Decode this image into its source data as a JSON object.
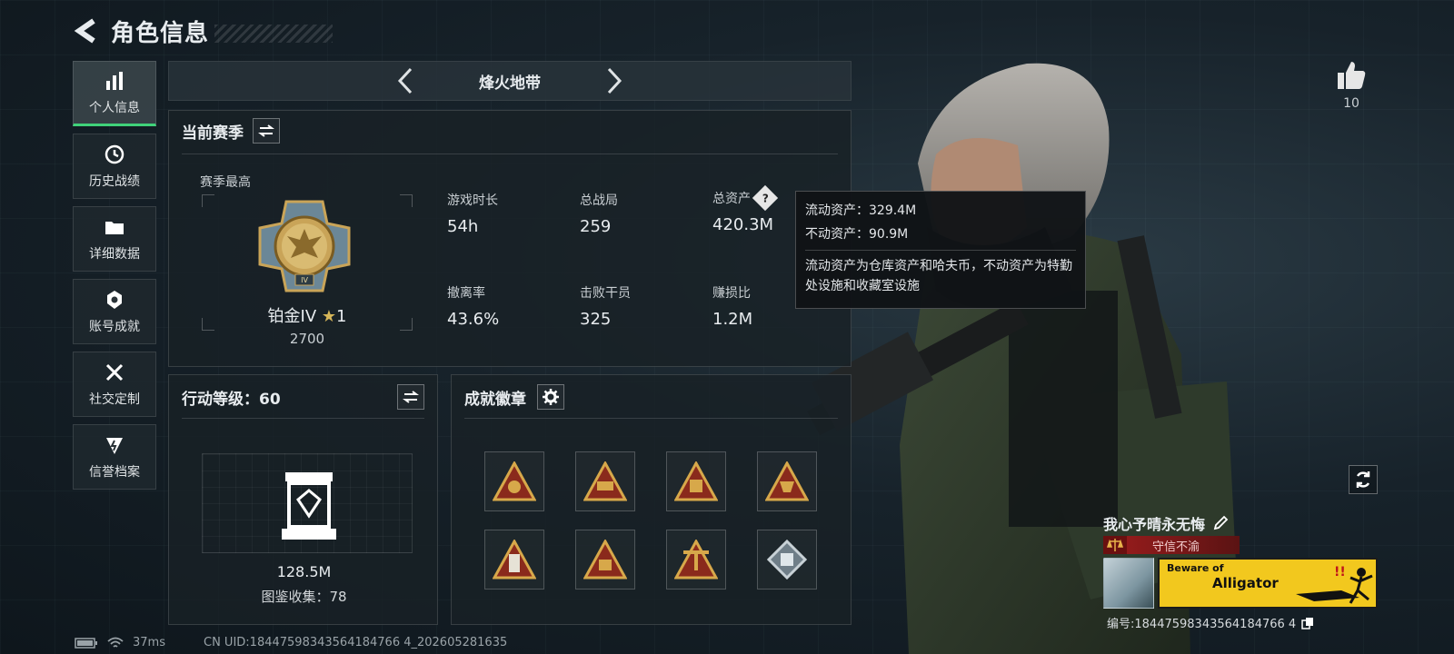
{
  "header": {
    "title": "角色信息"
  },
  "sidebar": {
    "items": [
      {
        "label": "个人信息",
        "icon": "bar-chart-icon",
        "active": true
      },
      {
        "label": "历史战绩",
        "icon": "history-icon"
      },
      {
        "label": "详细数据",
        "icon": "folder-icon"
      },
      {
        "label": "账号成就",
        "icon": "achievement-icon"
      },
      {
        "label": "社交定制",
        "icon": "tools-icon"
      },
      {
        "label": "信誉档案",
        "icon": "credit-icon"
      }
    ]
  },
  "top_nav": {
    "title": "烽火地带"
  },
  "season": {
    "title": "当前赛季",
    "best_label": "赛季最高",
    "rank_name": "铂金IV",
    "rank_stars": "1",
    "rank_score": "2700",
    "stats": [
      {
        "label": "游戏时长",
        "value": "54h"
      },
      {
        "label": "总战局",
        "value": "259"
      },
      {
        "label": "总资产",
        "value": "420.3M"
      },
      {
        "label": "撤离率",
        "value": "43.6%"
      },
      {
        "label": "击败干员",
        "value": "325"
      },
      {
        "label": "赚损比",
        "value": "1.2M"
      }
    ]
  },
  "tooltip": {
    "liquid": "流动资产：329.4M",
    "fixed": "不动资产：90.9M",
    "desc": "流动资产为仓库资产和哈夫币，不动资产为特勤处设施和收藏室设施"
  },
  "action_level": {
    "title": "行动等级：60",
    "value": "128.5M",
    "collection": "图鉴收集：78"
  },
  "achievements": {
    "title": "成就徽章",
    "badges": [
      "badge-1",
      "badge-2",
      "badge-3",
      "badge-4",
      "badge-5",
      "badge-6",
      "badge-7",
      "badge-8"
    ]
  },
  "status": {
    "ping": "37ms",
    "uid": "CN UID:18447598343564184766 4_202605281635"
  },
  "profile": {
    "likes": "10",
    "name": "我心予晴永无悔",
    "trust": "守信不渝",
    "banner_top": "Beware of",
    "banner_main": "Alligator",
    "id": "编号:18447598343564184766 4"
  },
  "colors": {
    "accent_green": "#3fd27a",
    "gold": "#d6b659",
    "trust_red": "#9e1d1d",
    "banner_yellow": "#f2c81e"
  }
}
